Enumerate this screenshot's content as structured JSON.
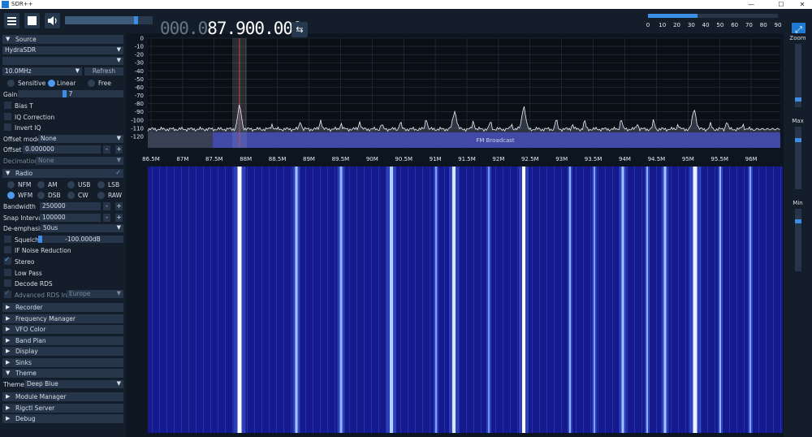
{
  "window": {
    "title": "SDR++",
    "minimize": "—",
    "maximize": "☐",
    "close": "✕"
  },
  "toolbar": {
    "volume": 0.83,
    "freq_dim": "000.0",
    "freq_bright": "87.900.000",
    "swap_icon": "⇆",
    "snr": {
      "fraction": 0.38,
      "ticks": [
        "0",
        "10",
        "20",
        "30",
        "40",
        "50",
        "60",
        "70",
        "80",
        "90"
      ]
    }
  },
  "sidebar": {
    "source": {
      "header": "Source",
      "device": "HydraSDR",
      "device2": "",
      "sample_rate": "10.0MHz",
      "refresh": "Refresh",
      "modes": [
        "Sensitive",
        "Linear",
        "Free"
      ],
      "selected_mode": 1,
      "gain_label": "Gain",
      "gain_value": "7",
      "gain_fraction": 0.44,
      "bias_t": "Bias T",
      "iq_correction": "IQ Correction",
      "invert_iq": "Invert IQ",
      "offset_mode_label": "Offset mode",
      "offset_mode": "None",
      "offset_label": "Offset",
      "offset_value": "0.000000",
      "decimation_label": "Decimation",
      "decimation": "None"
    },
    "radio": {
      "header": "Radio",
      "modes": [
        "NFM",
        "AM",
        "USB",
        "LSB",
        "WFM",
        "DSB",
        "CW",
        "RAW"
      ],
      "selected_mode": 4,
      "bandwidth_label": "Bandwidth",
      "bandwidth": "250000",
      "snap_label": "Snap Interval",
      "snap": "100000",
      "deemph_label": "De-emphasis",
      "deemph": "50us",
      "squelch_label": "Squelch",
      "squelch_value": "-100.000dB",
      "squelch_fraction": 0.0,
      "if_nr": "IF Noise Reduction",
      "stereo": "Stereo",
      "low_pass": "Low Pass",
      "decode_rds": "Decode RDS",
      "adv_rds": "Advanced RDS Info",
      "region": "Europe"
    },
    "collapsed": [
      "Recorder",
      "Frequency Manager",
      "VFO Color",
      "Band Plan",
      "Display",
      "Sinks"
    ],
    "theme": {
      "header": "Theme",
      "label": "Theme",
      "value": "Deep Blue"
    },
    "bottom": [
      "Module Manager",
      "Rigctl Server",
      "Debug"
    ],
    "minus": "-",
    "plus": "+"
  },
  "spectrum": {
    "y_ticks": [
      "0",
      "-10",
      "-20",
      "-30",
      "-40",
      "-50",
      "-60",
      "-70",
      "-80",
      "-90",
      "-100",
      "-110",
      "-120"
    ],
    "x_ticks": [
      "86.5M",
      "87M",
      "87.5M",
      "88M",
      "88.5M",
      "89M",
      "89.5M",
      "90M",
      "90.5M",
      "91M",
      "91.5M",
      "92M",
      "92.5M",
      "93M",
      "93.5M",
      "94M",
      "94.5M",
      "95M",
      "95.5M",
      "96M"
    ],
    "band_label": "FM Broadcast",
    "band_color": "#2a2fb0",
    "vfo_color": "#d04040"
  },
  "right": {
    "zoom": "Zoom",
    "max": "Max",
    "min": "Min",
    "zoom_fraction": 0.9,
    "max_fraction": 0.2,
    "min_fraction": 0.18
  },
  "colors": {
    "accent": "#3a8ee6",
    "panel": "#141e2b",
    "waterfall": "#141a8c"
  }
}
